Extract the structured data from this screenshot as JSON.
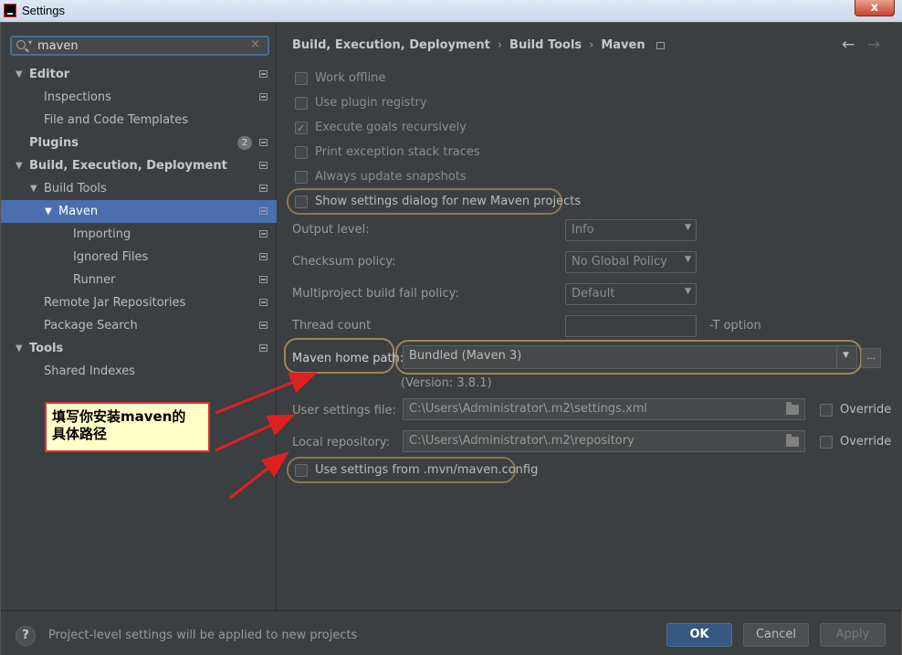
{
  "titlebar": {
    "title": "Settings",
    "close": "x"
  },
  "search": {
    "value": "maven",
    "clear": "×"
  },
  "tree": [
    {
      "label": "Editor",
      "bold": true,
      "expanded": true
    },
    {
      "label": "Inspections"
    },
    {
      "label": "File and Code Templates"
    },
    {
      "label": "Plugins",
      "bold": true,
      "badge": "2"
    },
    {
      "label": "Build, Execution, Deployment",
      "bold": true,
      "expanded": true
    },
    {
      "label": "Build Tools",
      "expanded": true
    },
    {
      "label": "Maven",
      "expanded": true,
      "selected": true
    },
    {
      "label": "Importing"
    },
    {
      "label": "Ignored Files"
    },
    {
      "label": "Runner"
    },
    {
      "label": "Remote Jar Repositories"
    },
    {
      "label": "Package Search"
    },
    {
      "label": "Tools",
      "bold": true,
      "expanded": true
    },
    {
      "label": "Shared Indexes"
    }
  ],
  "breadcrumb": {
    "part1": "Build, Execution, Deployment",
    "part2": "Build Tools",
    "part3": "Maven",
    "sep": "›"
  },
  "nav": {
    "back": "←",
    "forward": "→"
  },
  "options": {
    "work_offline": {
      "label": "Work offline",
      "checked": false
    },
    "plugin_registry": {
      "label": "Use plugin registry",
      "checked": false
    },
    "execute_recursively": {
      "label": "Execute goals recursively",
      "checked": true
    },
    "print_stack": {
      "label": "Print exception stack traces",
      "checked": false
    },
    "update_snapshots": {
      "label": "Always update snapshots",
      "checked": false
    },
    "show_dialog": {
      "label": "Show settings dialog for new Maven projects",
      "checked": false
    }
  },
  "fields": {
    "output_level": {
      "label": "Output level:",
      "value": "Info"
    },
    "checksum_policy": {
      "label": "Checksum policy:",
      "value": "No Global Policy"
    },
    "fail_policy": {
      "label": "Multiproject build fail policy:",
      "value": "Default"
    },
    "thread_count": {
      "label": "Thread count",
      "value": "",
      "suffix": "-T option"
    },
    "maven_home": {
      "label": "Maven home path:",
      "value": "Bundled (Maven 3)",
      "browse": "...",
      "version": "(Version: 3.8.1)"
    },
    "user_settings": {
      "label": "User settings file:",
      "value": "C:\\Users\\Administrator\\.m2\\settings.xml",
      "override": "Override"
    },
    "local_repo": {
      "label": "Local repository:",
      "value": "C:\\Users\\Administrator\\.m2\\repository",
      "override": "Override"
    },
    "mvn_config": {
      "label": "Use settings from .mvn/maven.config",
      "checked": false
    }
  },
  "annotation": {
    "line1": "填写你安装maven的",
    "line2": "具体路径"
  },
  "footer": {
    "help": "?",
    "message": "Project-level settings will be applied to new projects",
    "ok": "OK",
    "cancel": "Cancel",
    "apply": "Apply"
  },
  "colors": {
    "selection": "#4b6eaf",
    "primary_button": "#365880",
    "highlight_ring": "#c8a464",
    "arrow_red": "#e02020"
  }
}
